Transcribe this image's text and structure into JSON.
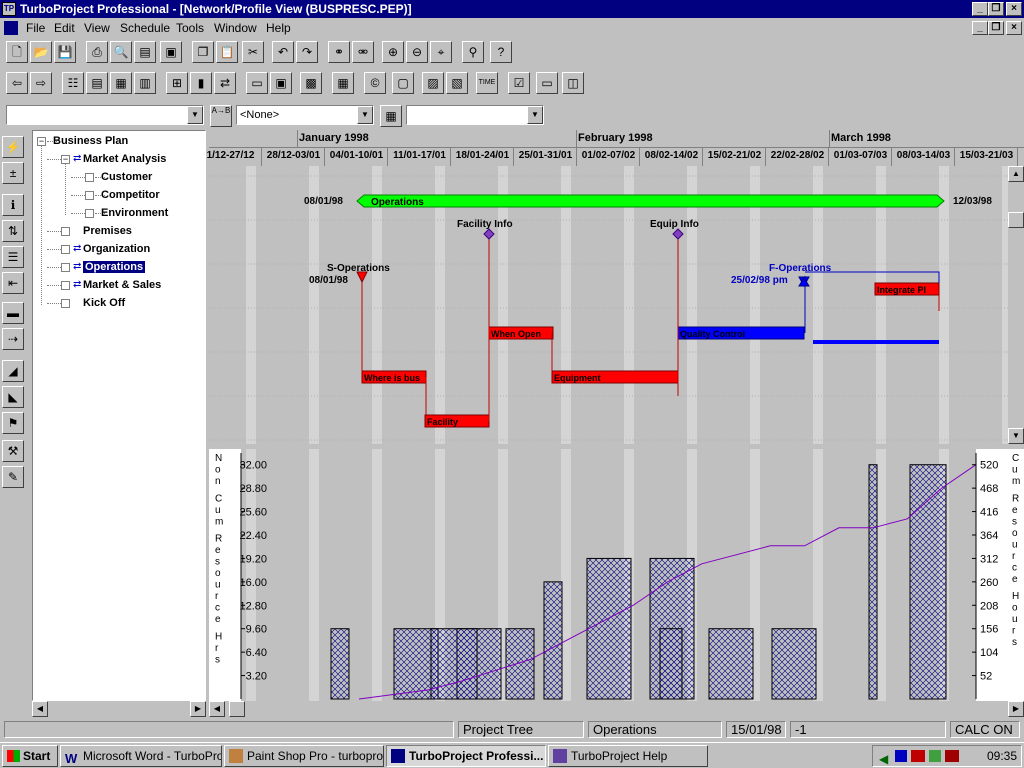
{
  "window": {
    "title": "TurboProject Professional - [Network/Profile View (BUSPRESC.PEP)]",
    "icon_label": "TP"
  },
  "menu": [
    "File",
    "Edit",
    "View",
    "Schedule",
    "Tools",
    "Window",
    "Help"
  ],
  "toolbar": {
    "combo1_value": "",
    "filter_value": "<None>",
    "combo3_value": "",
    "sort_label": "A→B"
  },
  "tree": {
    "items": [
      {
        "label": "Business Plan",
        "level": 0,
        "box": "−"
      },
      {
        "label": "Market Analysis",
        "level": 1,
        "box": "−"
      },
      {
        "label": "Customer",
        "level": 2,
        "box": ""
      },
      {
        "label": "Competitor",
        "level": 2,
        "box": ""
      },
      {
        "label": "Environment",
        "level": 2,
        "box": ""
      },
      {
        "label": "Premises",
        "level": 1,
        "box": ""
      },
      {
        "label": "Organization",
        "level": 1,
        "box": ""
      },
      {
        "label": "Operations",
        "level": 1,
        "box": "",
        "selected": true
      },
      {
        "label": "Market & Sales",
        "level": 1,
        "box": ""
      },
      {
        "label": "Kick Off",
        "level": 1,
        "box": ""
      }
    ]
  },
  "timeline": {
    "months": [
      "January 1998",
      "February 1998",
      "March 1998"
    ],
    "weeks": [
      "1/12-27/12",
      "28/12-03/01",
      "04/01-10/01",
      "11/01-17/01",
      "18/01-24/01",
      "25/01-31/01",
      "01/02-07/02",
      "08/02-14/02",
      "15/02-21/02",
      "22/02-28/02",
      "01/03-07/03",
      "08/03-14/03",
      "15/03-21/03"
    ]
  },
  "network": {
    "summary": {
      "label": "Operations",
      "start": "08/01/98",
      "end": "12/03/98"
    },
    "milestones": [
      {
        "label": "S-Operations",
        "date": "08/01/98"
      },
      {
        "label": "Facility Info"
      },
      {
        "label": "Equip Info"
      },
      {
        "label": "F-Operations",
        "date": "25/02/98 pm"
      }
    ],
    "tasks": [
      {
        "label": "Where is bus"
      },
      {
        "label": "Facility"
      },
      {
        "label": "When Open"
      },
      {
        "label": "Equipment"
      },
      {
        "label": "Quality Control"
      },
      {
        "label": "Integrate Pl"
      }
    ]
  },
  "chart_data": {
    "type": "bar",
    "categories": [
      "04/01-10/01",
      "11/01-17/01",
      "18/01-24/01",
      "25/01-31/01",
      "01/02-07/02",
      "08/02-14/02",
      "15/02-21/02",
      "22/02-28/02",
      "01/03-07/03",
      "08/03-14/03"
    ],
    "values": [
      9.6,
      9.6,
      9.6,
      16,
      19.2,
      19.2,
      9.6,
      9.6,
      32,
      32
    ],
    "cumulative": [
      0,
      10,
      20,
      40,
      64,
      88,
      128,
      168,
      208,
      260,
      300,
      320,
      340,
      340,
      380,
      380,
      400,
      468,
      520
    ],
    "left_axis_label": "Non Cum Resource Hrs",
    "right_axis_label": "Cum Resource Hours",
    "left_ticks": [
      "32.00",
      "28.80",
      "25.60",
      "22.40",
      "19.20",
      "16.00",
      "12.80",
      "9.60",
      "6.40",
      "3.20"
    ],
    "right_ticks": [
      "520",
      "468",
      "416",
      "364",
      "312",
      "260",
      "208",
      "156",
      "104",
      "52"
    ],
    "ylim": [
      0,
      33.6
    ],
    "ylim_right": [
      0,
      546
    ]
  },
  "status": {
    "pane1": "",
    "pane2": "Project Tree",
    "pane3": "Operations",
    "pane4": "15/01/98",
    "pane5": "-1",
    "pane6": "CALC ON"
  },
  "taskbar": {
    "start": "Start",
    "tasks": [
      "Microsoft Word - TurboProj...",
      "Paint Shop Pro - turboproje...",
      "TurboProject Professi...",
      "TurboProject Help"
    ],
    "clock": "09:35"
  }
}
